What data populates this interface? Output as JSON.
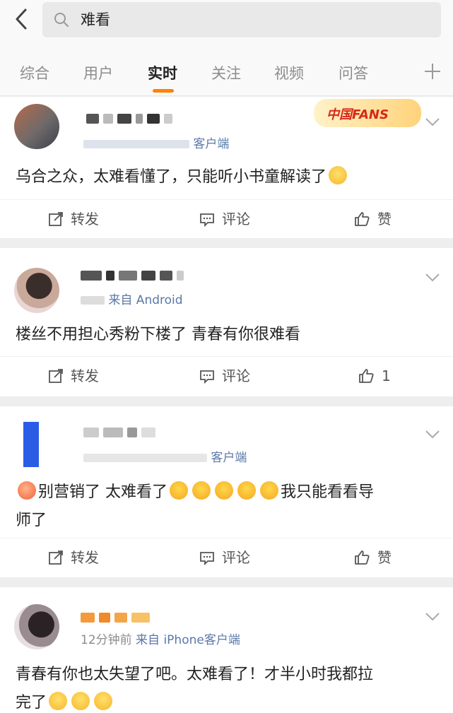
{
  "search": {
    "query": "难看"
  },
  "tabs": [
    {
      "label": "综合"
    },
    {
      "label": "用户"
    },
    {
      "label": "实时"
    },
    {
      "label": "关注"
    },
    {
      "label": "视频"
    },
    {
      "label": "问答"
    }
  ],
  "badge": {
    "text": "中国FANS"
  },
  "posts": [
    {
      "meta_time": "",
      "meta_source": "客户端",
      "content": "乌合之众，太难看懂了，只能听小书童解读了",
      "repost_label": "转发",
      "comment_label": "评论",
      "like_label": "赞"
    },
    {
      "meta_time": "",
      "meta_source": "来自 Android",
      "content": "楼丝不用担心秀粉下楼了  青春有你很难看",
      "repost_label": "转发",
      "comment_label": "评论",
      "like_label": "1"
    },
    {
      "meta_time": "",
      "meta_source": "客户端",
      "content_a": "别营销了 太难看了",
      "content_b": "我只能看看导",
      "content_c": "师了",
      "repost_label": "转发",
      "comment_label": "评论",
      "like_label": "赞"
    },
    {
      "meta_time": "12分钟前",
      "meta_source": "来自 iPhone客户端",
      "content_a": "青春有你也太失望了吧。太难看了！才半小时我都拉",
      "content_b": "完了"
    }
  ]
}
